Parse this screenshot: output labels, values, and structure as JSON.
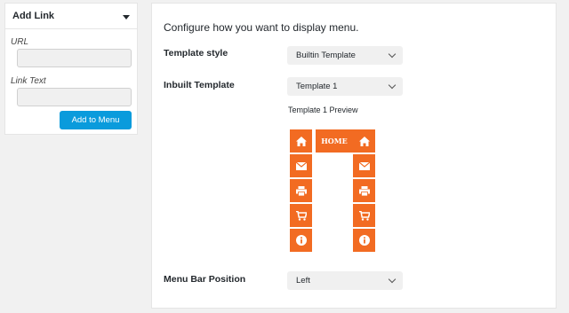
{
  "add_link": {
    "title": "Add Link",
    "url_label": "URL",
    "url_value": "",
    "link_text_label": "Link Text",
    "link_text_value": "",
    "add_button": "Add to Menu"
  },
  "config": {
    "heading": "Configure how you want to display menu.",
    "template_style_label": "Template style",
    "template_style_value": "Builtin Template",
    "inbuilt_template_label": "Inbuilt Template",
    "inbuilt_template_value": "Template 1",
    "preview_label": "Template 1 Preview",
    "menu_position_label": "Menu Bar Position",
    "menu_position_value": "Left"
  },
  "preview": {
    "home_label": "HOME",
    "accent_color": "#f26b22",
    "icons": [
      "home-icon",
      "envelope-icon",
      "print-icon",
      "cart-icon",
      "info-icon"
    ]
  }
}
